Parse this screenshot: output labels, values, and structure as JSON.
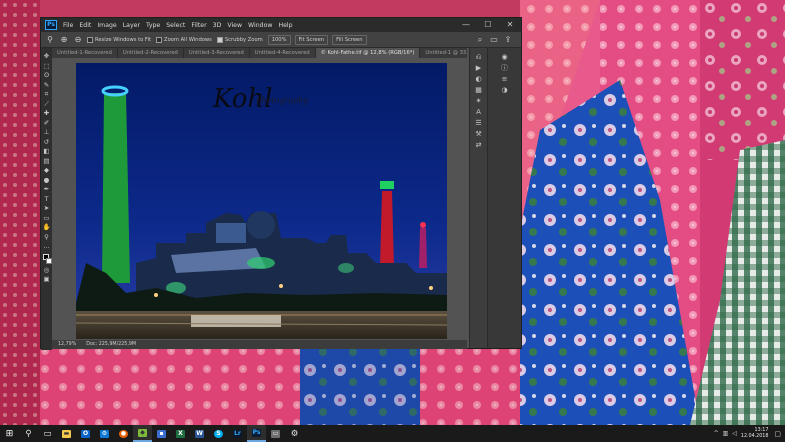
{
  "photoshop": {
    "logo": "Ps",
    "menus": [
      "File",
      "Edit",
      "Image",
      "Layer",
      "Type",
      "Select",
      "Filter",
      "3D",
      "View",
      "Window",
      "Help"
    ],
    "window_controls": {
      "minimize": "—",
      "maximize": "☐",
      "close": "✕"
    },
    "options_bar": {
      "resize_windows": "Resize Windows to Fit",
      "zoom_all": "Zoom All Windows",
      "scrubby_zoom": "Scrubby Zoom",
      "percent_button": "100%",
      "fit_screen": "Fit Screen",
      "fill_screen": "Fill Screen"
    },
    "tabs": [
      {
        "label": "Untitled-1-Recovered"
      },
      {
        "label": "Untitled-2-Recovered"
      },
      {
        "label": "Untitled-3-Recovered"
      },
      {
        "label": "Untitled-4-Recovered"
      },
      {
        "label": "© Kohl-Fathe.tif @ 12,8% (RGB/16*)"
      },
      {
        "label": "Untitled-1 @ 33..."
      },
      {
        "label": "Ub"
      }
    ],
    "watermark_text": "Kohl Photography",
    "status": {
      "zoom": "12,79%",
      "doc": "Doc: 225,9M/225,9M"
    }
  },
  "taskbar": {
    "start_icon": "windows-logo",
    "time": "13:17",
    "date": "12.04.2018"
  },
  "colors": {
    "ps_chrome": "#535353",
    "ps_menubar": "#2b2b2b",
    "ps_accent": "#31a8ff",
    "taskbar": "#1a1a1a",
    "sky": "#0d2a8c"
  }
}
